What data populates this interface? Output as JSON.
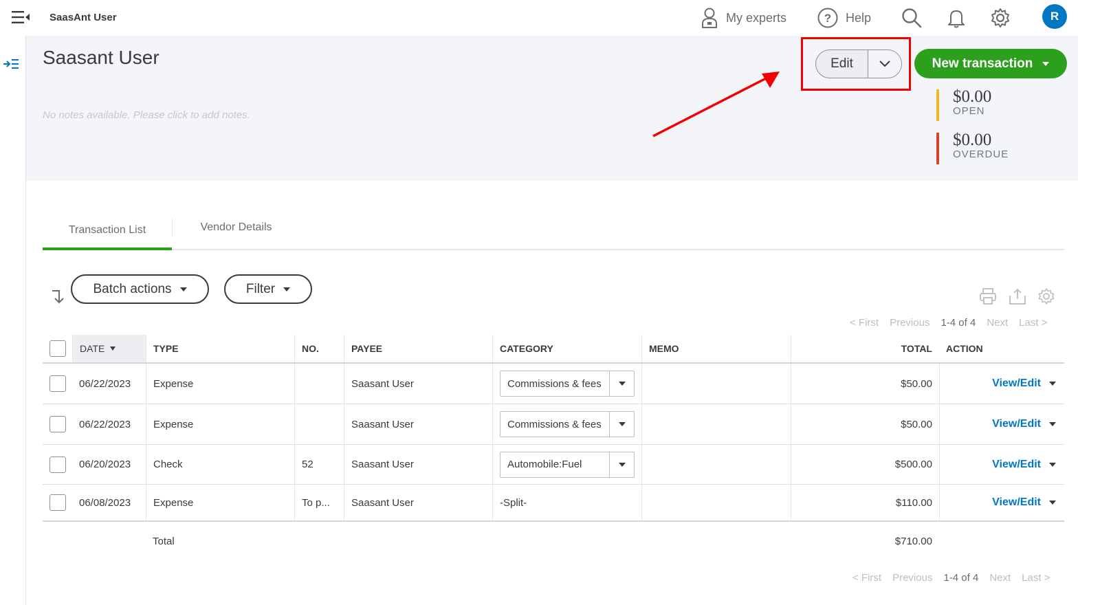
{
  "topbar": {
    "app_title": "SaasAnt User",
    "my_experts": "My experts",
    "help": "Help",
    "avatar_initial": "R"
  },
  "vendor": {
    "name": "Saasant User",
    "notes_placeholder": "No notes available. Please click to add notes.",
    "edit_label": "Edit",
    "new_transaction_label": "New transaction",
    "open_amount": "$0.00",
    "open_label": "OPEN",
    "overdue_amount": "$0.00",
    "overdue_label": "OVERDUE"
  },
  "tabs": [
    {
      "label": "Transaction List",
      "active": true
    },
    {
      "label": "Vendor Details",
      "active": false
    }
  ],
  "toolbar": {
    "batch_actions": "Batch actions",
    "filter": "Filter"
  },
  "pager": {
    "first": "< First",
    "previous": "Previous",
    "count": "1-4 of 4",
    "next": "Next",
    "last": "Last >"
  },
  "table": {
    "headers": {
      "date": "DATE",
      "type": "TYPE",
      "no": "NO.",
      "payee": "PAYEE",
      "category": "CATEGORY",
      "memo": "MEMO",
      "total": "TOTAL",
      "action": "ACTION"
    },
    "rows": [
      {
        "date": "06/22/2023",
        "type": "Expense",
        "no": "",
        "payee": "Saasant User",
        "category": "Commissions & fees",
        "memo": "",
        "total": "$50.00",
        "action": "View/Edit"
      },
      {
        "date": "06/22/2023",
        "type": "Expense",
        "no": "",
        "payee": "Saasant User",
        "category": "Commissions & fees",
        "memo": "",
        "total": "$50.00",
        "action": "View/Edit"
      },
      {
        "date": "06/20/2023",
        "type": "Check",
        "no": "52",
        "payee": "Saasant User",
        "category": "Automobile:Fuel",
        "memo": "",
        "total": "$500.00",
        "action": "View/Edit"
      },
      {
        "date": "06/08/2023",
        "type": "Expense",
        "no": "To p...",
        "payee": "Saasant User",
        "category": "-Split-",
        "memo": "",
        "total": "$110.00",
        "action": "View/Edit"
      }
    ],
    "total_label": "Total",
    "total_value": "$710.00"
  },
  "colors": {
    "brand_green": "#2ca01c",
    "link_blue": "#0077c5",
    "open_bar": "#f2b824",
    "overdue_bar": "#d6402b",
    "highlight_red": "#f50000"
  },
  "icons": [
    "hamburger-icon",
    "user-experts-icon",
    "help-icon",
    "search-icon",
    "bell-icon",
    "gear-icon",
    "print-icon",
    "export-icon",
    "settings-icon"
  ]
}
